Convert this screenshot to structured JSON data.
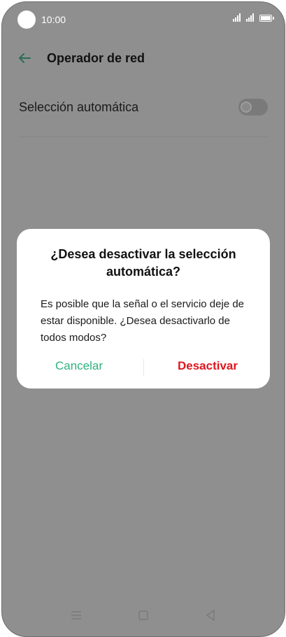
{
  "status_bar": {
    "time": "10:00"
  },
  "header": {
    "title": "Operador de red"
  },
  "setting": {
    "label": "Selección automática",
    "enabled": false
  },
  "dialog": {
    "title": "¿Desea desactivar la selección automática?",
    "message": "Es posible que la señal o el servicio deje de estar disponible. ¿Desea desactivarlo de todos modos?",
    "cancel_label": "Cancelar",
    "confirm_label": "Desactivar"
  },
  "colors": {
    "accent": "#2eb37f",
    "danger": "#e0161e",
    "scrim": "#8f8f8f"
  },
  "icons": {
    "back": "arrow-left-icon",
    "menu": "menu-icon",
    "home": "home-icon",
    "nav_back": "triangle-back-icon"
  }
}
